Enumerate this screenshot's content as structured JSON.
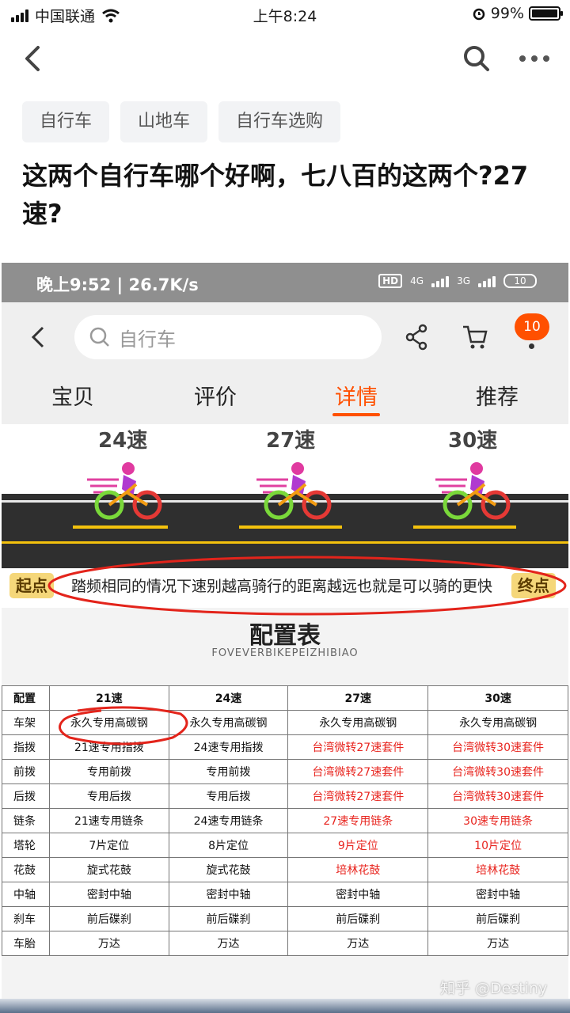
{
  "status_bar": {
    "carrier": "中国联通",
    "time": "上午8:24",
    "battery": "99%"
  },
  "tags": [
    "自行车",
    "山地车",
    "自行车选购"
  ],
  "question_title": "这两个自行车哪个好啊，七八百的这两个?27速?",
  "embedded": {
    "status": {
      "time_speed": "晚上9:52 | 26.7K/s",
      "hd": "HD",
      "net1": "4G",
      "net2": "3G",
      "battery": "10"
    },
    "search_placeholder": "自行车",
    "cart_badge": "10",
    "tabs": [
      "宝贝",
      "评价",
      "详情",
      "推荐"
    ],
    "active_tab": "详情",
    "speeds": [
      "24速",
      "27速",
      "30速"
    ],
    "start_label": "起点",
    "end_label": "终点",
    "banner_text": "踏频相同的情况下速别越高骑行的距离越远也就是可以骑的更快",
    "config_title": "配置表",
    "config_subtitle": "FOVEVERBIKEPEIZHIBIAO",
    "table": {
      "header": [
        "配置",
        "21速",
        "24速",
        "27速",
        "30速"
      ],
      "rows": [
        [
          "车架",
          "永久专用高碳钢",
          "永久专用高碳钢",
          "永久专用高碳钢",
          "永久专用高碳钢"
        ],
        [
          "指拨",
          "21速专用指拨",
          "24速专用指拨",
          "台湾微转27速套件",
          "台湾微转30速套件"
        ],
        [
          "前拨",
          "专用前拨",
          "专用前拨",
          "台湾微转27速套件",
          "台湾微转30速套件"
        ],
        [
          "后拨",
          "专用后拨",
          "专用后拨",
          "台湾微转27速套件",
          "台湾微转30速套件"
        ],
        [
          "链条",
          "21速专用链条",
          "24速专用链条",
          "27速专用链条",
          "30速专用链条"
        ],
        [
          "塔轮",
          "7片定位",
          "8片定位",
          "9片定位",
          "10片定位"
        ],
        [
          "花鼓",
          "旋式花鼓",
          "旋式花鼓",
          "培林花鼓",
          "培林花鼓"
        ],
        [
          "中轴",
          "密封中轴",
          "密封中轴",
          "密封中轴",
          "密封中轴"
        ],
        [
          "刹车",
          "前后碟刹",
          "前后碟刹",
          "前后碟刹",
          "前后碟刹"
        ],
        [
          "车胎",
          "万达",
          "万达",
          "万达",
          "万达"
        ]
      ]
    }
  },
  "watermark": "知乎 @Destiny",
  "colors": {
    "accent": "#ff5000",
    "red_text": "#e8251f",
    "annotation": "#e3241b"
  }
}
